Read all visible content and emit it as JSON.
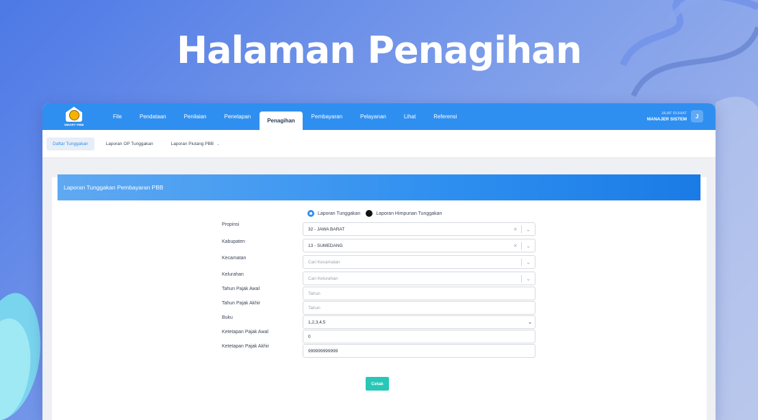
{
  "hero": {
    "title": "Halaman Penagihan"
  },
  "app": {
    "logo_text": "SMART PBB",
    "nav": [
      "File",
      "Pendataan",
      "Penilaian",
      "Penetapan",
      "Penagihan",
      "Pembayaran",
      "Pelayanan",
      "Lihat",
      "Referensi"
    ],
    "active_nav": "Penagihan",
    "user": {
      "name": "JAJAT RUHIAT",
      "role": "MANAJER SISTEM",
      "avatar": "J"
    },
    "subnav": [
      "Daftar Tunggakan",
      "Laporan OP Tunggakan",
      "Laporan Piutang PBB"
    ],
    "active_subnav": "Daftar Tunggakan"
  },
  "panel": {
    "title": "Laporan Tunggakan Pembayaran PBB",
    "radios": [
      {
        "label": "Laporan Tunggakan",
        "checked": true
      },
      {
        "label": "Laporan Himpunan Tunggakan",
        "checked": false
      }
    ],
    "fields": {
      "propinsi": {
        "label": "Propinsi",
        "value": "32 - JAWA BARAT"
      },
      "kabupaten": {
        "label": "Kabupaten",
        "value": "13 - SUMEDANG"
      },
      "kecamatan": {
        "label": "Kecamatan",
        "placeholder": "Cari Kecamatan"
      },
      "kelurahan": {
        "label": "Kelurahan",
        "placeholder": "Cari Kelurahan"
      },
      "tahun_awal": {
        "label": "Tahun Pajak Awal",
        "placeholder": "Tahun"
      },
      "tahun_akhir": {
        "label": "Tahun Pajak Akhir",
        "placeholder": "Tahun"
      },
      "buku": {
        "label": "Buku",
        "value": "1,2,3,4,5"
      },
      "ketetapan_awal": {
        "label": "Ketetapan Pajak Awal",
        "value": "0"
      },
      "ketetapan_akhir": {
        "label": "Ketetapan Pajak Akhir",
        "value": "999999999999"
      }
    },
    "submit_label": "Cetak"
  },
  "colors": {
    "primary": "#2f8ff0",
    "submit": "#28c7b7",
    "bg_gradient_start": "#4d79e6"
  }
}
